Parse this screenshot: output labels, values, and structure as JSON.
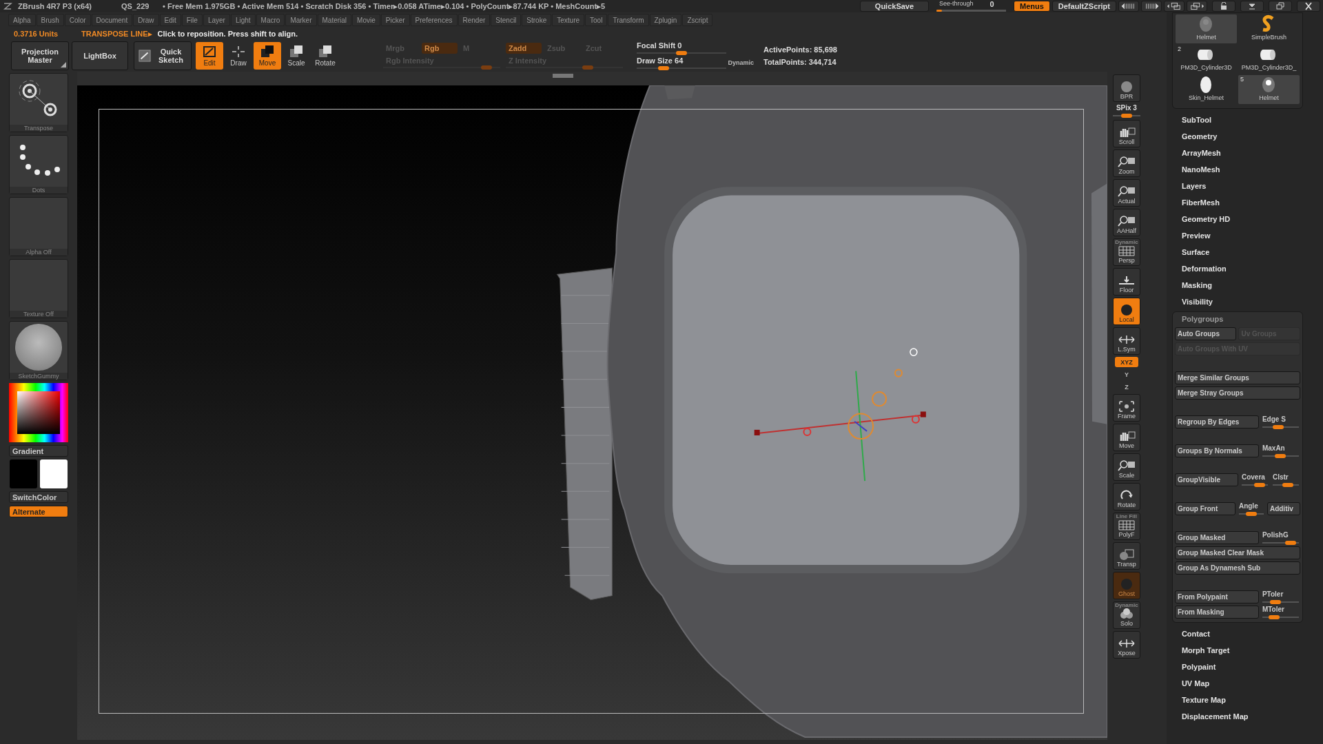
{
  "title_bar": {
    "app": "ZBrush 4R7 P3 (x64)",
    "file": "QS_229",
    "stats": "• Free Mem 1.975GB • Active Mem 514 • Scratch Disk 356 • Timer▸0.058 ATime▸0.104 • PolyCount▸87.744 KP • MeshCount▸5",
    "quicksave": "QuickSave",
    "see_through": {
      "label": "See-through",
      "value": "0",
      "level": 0.08
    },
    "menus": {
      "label": "Menus",
      "on": true
    },
    "script": "DefaultZScript"
  },
  "menu_bar": [
    "Alpha",
    "Brush",
    "Color",
    "Document",
    "Draw",
    "Edit",
    "File",
    "Layer",
    "Light",
    "Macro",
    "Marker",
    "Material",
    "Movie",
    "Picker",
    "Preferences",
    "Render",
    "Stencil",
    "Stroke",
    "Texture",
    "Tool",
    "Transform",
    "Zplugin",
    "Zscript"
  ],
  "notice": {
    "units": "0.3716 Units",
    "mode": "TRANSPOSE LINE▸",
    "message": "Click to reposition. Press shift to align."
  },
  "shelf": {
    "large_buttons": [
      {
        "label": "Projection Master",
        "kind": "menu"
      },
      {
        "label": "LightBox",
        "kind": "plain"
      },
      {
        "label": "Quick Sketch",
        "kind": "sketch"
      }
    ],
    "tools": [
      {
        "kind": "edit",
        "label": "Edit",
        "on": true
      },
      {
        "kind": "draw",
        "label": "Draw",
        "on": false
      },
      {
        "kind": "move",
        "label": "Move",
        "on": true
      },
      {
        "kind": "scale",
        "label": "Scale",
        "on": false
      },
      {
        "kind": "rotate",
        "label": "Rotate",
        "on": false
      }
    ],
    "channels": [
      {
        "toggles": [
          {
            "label": "Mrgb",
            "on": false
          },
          {
            "label": "Rgb",
            "on": true
          },
          {
            "label": "M",
            "on": false
          }
        ],
        "slider": {
          "label": "Rgb Intensity",
          "level": 0.92
        }
      },
      {
        "toggles": [
          {
            "label": "Zadd",
            "on": true
          },
          {
            "label": "Zsub",
            "on": false
          },
          {
            "label": "Zcut",
            "on": false
          }
        ],
        "slider": {
          "label": "Z Intensity",
          "level": 0.72
        }
      }
    ],
    "sliders": [
      {
        "label": "Focal Shift",
        "value": "0",
        "level": 0.5
      },
      {
        "label": "Draw Size",
        "value": "64",
        "level": 0.27,
        "tag": "Dynamic"
      }
    ],
    "points": [
      "ActivePoints: 85,698",
      "TotalPoints: 344,714"
    ]
  },
  "left_tray": {
    "thumbs": [
      {
        "kind": "transpose",
        "label": "Transpose"
      },
      {
        "kind": "dots",
        "label": "Dots"
      },
      {
        "kind": "blank",
        "label": "Alpha Off"
      },
      {
        "kind": "blank",
        "label": "Texture Off"
      },
      {
        "kind": "material",
        "label": "SketchGummy"
      }
    ],
    "gradient": "Gradient",
    "switch": "SwitchColor",
    "alternate": {
      "label": "Alternate",
      "on": true
    }
  },
  "right_shelf": [
    {
      "kind": "bpr",
      "label": "BPR",
      "on": false
    },
    {
      "kind": "slider",
      "label": "SPix 3",
      "level": 0.5
    },
    {
      "kind": "scroll",
      "label": "Scroll",
      "on": false
    },
    {
      "kind": "zoom",
      "label": "Zoom",
      "on": false
    },
    {
      "kind": "actual",
      "label": "Actual",
      "on": false
    },
    {
      "kind": "aahalf",
      "label": "AAHalf",
      "on": false
    },
    {
      "kind": "persp",
      "label": "Persp",
      "tag": "Dynamic",
      "on": false
    },
    {
      "kind": "floor",
      "label": "Floor",
      "on": false
    },
    {
      "kind": "local",
      "label": "Local",
      "on": true
    },
    {
      "kind": "lsym",
      "label": "L.Sym",
      "on": false
    },
    {
      "kind": "small",
      "label": "XYZ",
      "on": true
    },
    {
      "kind": "small",
      "label": "Y",
      "on": false
    },
    {
      "kind": "small",
      "label": "Z",
      "on": false
    },
    {
      "kind": "frame",
      "label": "Frame",
      "on": false
    },
    {
      "kind": "move",
      "label": "Move",
      "on": false
    },
    {
      "kind": "scale",
      "label": "Scale",
      "on": false
    },
    {
      "kind": "rotate",
      "label": "Rotate",
      "on": false
    },
    {
      "kind": "polyf",
      "label": "PolyF",
      "tag": "Line Fill",
      "on": false
    },
    {
      "kind": "transp",
      "label": "Transp",
      "on": false
    },
    {
      "kind": "ghost",
      "label": "Ghost",
      "on": true
    },
    {
      "kind": "solo",
      "label": "Solo",
      "tag": "Dynamic",
      "on": false
    },
    {
      "kind": "xpose",
      "label": "Xpose",
      "on": false
    }
  ],
  "right_tray": {
    "subtools": [
      {
        "kind": "head",
        "label": "Helmet",
        "selected": true
      },
      {
        "kind": "brush",
        "label": "SimpleBrush",
        "selected": false
      },
      {
        "kind": "cylinder",
        "label": "PM3D_Cylinder3D",
        "count": "2",
        "selected": false
      },
      {
        "kind": "cylinder",
        "label": "PM3D_Cylinder3D_",
        "selected": false
      },
      {
        "kind": "egg",
        "label": "Skin_Helmet",
        "selected": false
      },
      {
        "kind": "head",
        "label": "Helmet",
        "count": "5",
        "selected": true
      }
    ],
    "menus_before": [
      "SubTool",
      "Geometry",
      "ArrayMesh",
      "NanoMesh",
      "Layers",
      "FiberMesh",
      "Geometry HD",
      "Preview",
      "Surface",
      "Deformation",
      "Masking",
      "Visibility"
    ],
    "polygroups": {
      "title": "Polygroups",
      "groups": [
        [
          [
            {
              "kind": "button",
              "label": "Auto Groups",
              "disabled": false
            },
            {
              "kind": "button",
              "label": "Uv Groups",
              "disabled": true
            }
          ],
          [
            {
              "kind": "button",
              "label": "Auto Groups With UV",
              "disabled": true
            }
          ]
        ],
        [
          [
            {
              "kind": "button",
              "label": "Merge Similar Groups",
              "disabled": false
            }
          ],
          [
            {
              "kind": "button",
              "label": "Merge Stray Groups",
              "disabled": false
            }
          ]
        ],
        [
          [
            {
              "kind": "button",
              "label": "Regroup By Edges",
              "disabled": false
            },
            {
              "kind": "slider",
              "label": "Edge S",
              "level": 0.4
            }
          ]
        ],
        [
          [
            {
              "kind": "button",
              "label": "Groups By Normals",
              "disabled": false
            },
            {
              "kind": "slider",
              "label": "MaxAn",
              "level": 0.5
            }
          ]
        ],
        [
          [
            {
              "kind": "button",
              "label": "GroupVisible",
              "disabled": false
            },
            {
              "kind": "slider",
              "label": "Covera",
              "level": 0.8
            },
            {
              "kind": "slider",
              "label": "Clstr",
              "level": 0.65
            }
          ]
        ],
        [
          [
            {
              "kind": "button",
              "label": "Group Front",
              "disabled": false
            },
            {
              "kind": "slider",
              "label": "Angle",
              "level": 0.5
            },
            {
              "kind": "small_button",
              "label": "Additiv",
              "disabled": false
            }
          ]
        ],
        [
          [
            {
              "kind": "button",
              "label": "Group Masked",
              "disabled": false
            },
            {
              "kind": "slider",
              "label": "PolishG",
              "level": 0.9
            }
          ],
          [
            {
              "kind": "button",
              "label": "Group Masked Clear Mask",
              "disabled": false
            }
          ],
          [
            {
              "kind": "button",
              "label": "Group As Dynamesh Sub",
              "disabled": false
            }
          ]
        ],
        [
          [
            {
              "kind": "button",
              "label": "From Polypaint",
              "disabled": false
            },
            {
              "kind": "slider",
              "label": "PToler",
              "level": 0.3
            }
          ],
          [
            {
              "kind": "button",
              "label": "From Masking",
              "disabled": false
            },
            {
              "kind": "slider",
              "label": "MToler",
              "level": 0.25
            }
          ]
        ]
      ]
    },
    "menus_after": [
      "Contact",
      "Morph Target",
      "Polypaint",
      "UV Map",
      "Texture Map",
      "Displacement Map"
    ]
  }
}
